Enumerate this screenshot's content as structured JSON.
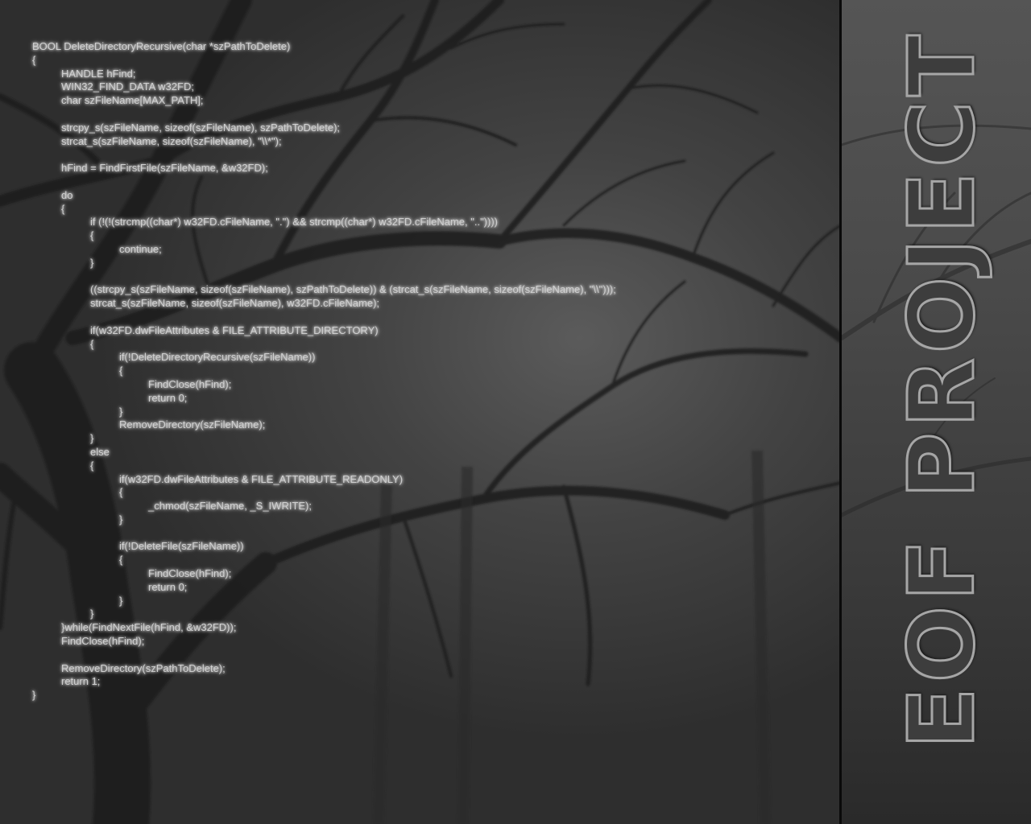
{
  "wallpaper": {
    "code_lines": [
      {
        "indent": 0,
        "text": "BOOL DeleteDirectoryRecursive(char *szPathToDelete)"
      },
      {
        "indent": 0,
        "text": "{"
      },
      {
        "indent": 1,
        "text": "HANDLE hFind;"
      },
      {
        "indent": 1,
        "text": "WIN32_FIND_DATA w32FD;"
      },
      {
        "indent": 1,
        "text": "char szFileName[MAX_PATH];"
      },
      {
        "indent": 0,
        "text": ""
      },
      {
        "indent": 1,
        "text": "strcpy_s(szFileName, sizeof(szFileName), szPathToDelete);"
      },
      {
        "indent": 1,
        "text": "strcat_s(szFileName, sizeof(szFileName), \"\\\\*\");"
      },
      {
        "indent": 0,
        "text": ""
      },
      {
        "indent": 1,
        "text": "hFind = FindFirstFile(szFileName, &w32FD);"
      },
      {
        "indent": 0,
        "text": ""
      },
      {
        "indent": 1,
        "text": "do"
      },
      {
        "indent": 1,
        "text": "{"
      },
      {
        "indent": 2,
        "text": "if (!(!(strcmp((char*) w32FD.cFileName, \".\") && strcmp((char*) w32FD.cFileName, \"..\"))))"
      },
      {
        "indent": 2,
        "text": "{"
      },
      {
        "indent": 3,
        "text": "continue;"
      },
      {
        "indent": 2,
        "text": "}"
      },
      {
        "indent": 0,
        "text": ""
      },
      {
        "indent": 2,
        "text": "((strcpy_s(szFileName, sizeof(szFileName), szPathToDelete)) & (strcat_s(szFileName, sizeof(szFileName), \"\\\\\")));"
      },
      {
        "indent": 2,
        "text": "strcat_s(szFileName, sizeof(szFileName), w32FD.cFileName);"
      },
      {
        "indent": 0,
        "text": ""
      },
      {
        "indent": 2,
        "text": "if(w32FD.dwFileAttributes & FILE_ATTRIBUTE_DIRECTORY)"
      },
      {
        "indent": 2,
        "text": "{"
      },
      {
        "indent": 3,
        "text": "if(!DeleteDirectoryRecursive(szFileName))"
      },
      {
        "indent": 3,
        "text": "{"
      },
      {
        "indent": 4,
        "text": "FindClose(hFind);"
      },
      {
        "indent": 4,
        "text": "return 0;"
      },
      {
        "indent": 3,
        "text": "}"
      },
      {
        "indent": 3,
        "text": "RemoveDirectory(szFileName);"
      },
      {
        "indent": 2,
        "text": "}"
      },
      {
        "indent": 2,
        "text": "else"
      },
      {
        "indent": 2,
        "text": "{"
      },
      {
        "indent": 3,
        "text": "if(w32FD.dwFileAttributes & FILE_ATTRIBUTE_READONLY)"
      },
      {
        "indent": 3,
        "text": "{"
      },
      {
        "indent": 4,
        "text": "_chmod(szFileName, _S_IWRITE);"
      },
      {
        "indent": 3,
        "text": "}"
      },
      {
        "indent": 0,
        "text": ""
      },
      {
        "indent": 3,
        "text": "if(!DeleteFile(szFileName))"
      },
      {
        "indent": 3,
        "text": "{"
      },
      {
        "indent": 4,
        "text": "FindClose(hFind);"
      },
      {
        "indent": 4,
        "text": "return 0;"
      },
      {
        "indent": 3,
        "text": "}"
      },
      {
        "indent": 2,
        "text": "}"
      },
      {
        "indent": 1,
        "text": "}while(FindNextFile(hFind, &w32FD));"
      },
      {
        "indent": 1,
        "text": "FindClose(hFind);"
      },
      {
        "indent": 0,
        "text": ""
      },
      {
        "indent": 1,
        "text": "RemoveDirectory(szPathToDelete);"
      },
      {
        "indent": 1,
        "text": "return 1;"
      },
      {
        "indent": 0,
        "text": "}"
      }
    ],
    "title": "EOF PROJECT",
    "colors": {
      "code_text": "#cfcfcf",
      "divider": "#0a0a0a",
      "title_outline": "#a6a6a6"
    }
  }
}
